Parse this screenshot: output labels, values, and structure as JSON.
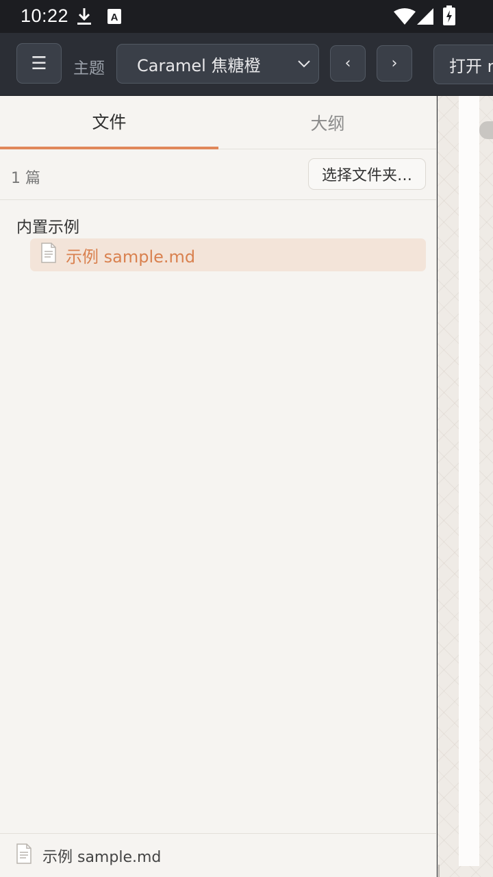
{
  "status_bar": {
    "time": "10:22",
    "icons": [
      "download-icon",
      "keyboard-a-icon",
      "wifi-icon",
      "signal-icon",
      "battery-charging-icon"
    ]
  },
  "toolbar": {
    "menu_icon": "☰",
    "theme_label": "主题",
    "theme_value": "Caramel 焦糖橙",
    "prev_label": "‹",
    "next_label": "›",
    "open_label": "打开 md"
  },
  "sidebar": {
    "tabs": [
      {
        "label": "文件",
        "active": true
      },
      {
        "label": "大纲",
        "active": false
      }
    ],
    "count_text": "1 篇",
    "choose_folder_label": "选择文件夹…",
    "group_label": "内置示例",
    "file_item_label": "示例 sample.md",
    "footer_label": "示例 sample.md"
  },
  "colors": {
    "accent": "#e0875a",
    "toolbar_bg": "#2b2e35",
    "sidebar_bg": "#f6f4f1",
    "selected_bg": "#f3e4d9"
  }
}
